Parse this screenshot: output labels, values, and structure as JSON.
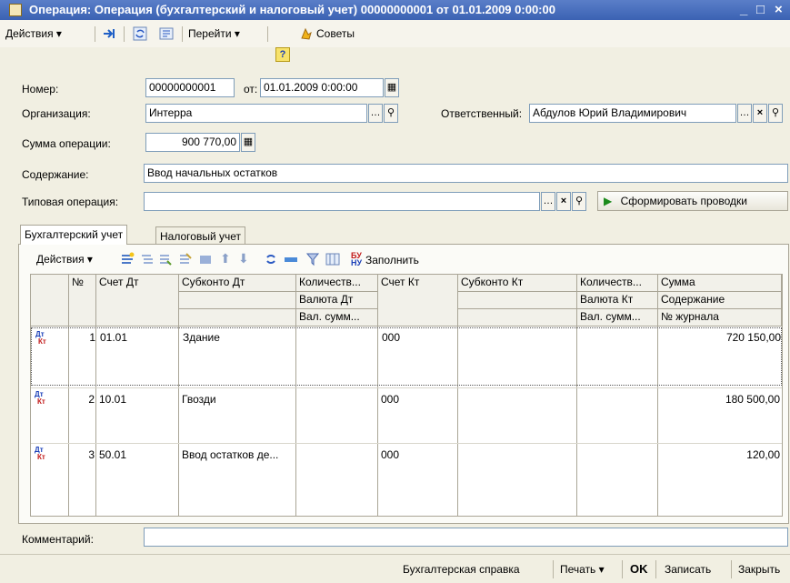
{
  "window": {
    "title": "Операция: Операция (бухгалтерский и налоговый учет) 00000000001 от 01.01.2009 0:00:00",
    "minimize": "_",
    "maximize": "□",
    "close": "×"
  },
  "toolbar": {
    "actions": "Действия",
    "goto": "Перейти",
    "help": "?",
    "tips": "Советы"
  },
  "form": {
    "number_label": "Номер:",
    "number_value": "00000000001",
    "from_label": "от:",
    "date_value": "01.01.2009  0:00:00",
    "org_label": "Организация:",
    "org_value": "Интерра",
    "resp_label": "Ответственный:",
    "resp_value": "Абдулов Юрий Владимирович",
    "sum_label": "Сумма операции:",
    "sum_value": "900 770,00",
    "content_label": "Содержание:",
    "content_value": "Ввод начальных остатков",
    "typical_label": "Типовая операция:",
    "typical_value": "",
    "generate_button": "Сформировать проводки",
    "comment_label": "Комментарий:",
    "comment_value": ""
  },
  "tabs": [
    "Бухгалтерский учет",
    "Налоговый учет"
  ],
  "table_toolbar": {
    "actions": "Действия",
    "fill": "Заполнить"
  },
  "table": {
    "headers": {
      "num": "№",
      "acc_dt": "Счет Дт",
      "sub_dt": "Субконто Дт",
      "qty_dt": "Количеств...",
      "cur_dt": "Валюта Дт",
      "cursum_dt": "Вал. сумм...",
      "acc_kt": "Счет Кт",
      "sub_kt": "Субконто Кт",
      "qty_kt": "Количеств...",
      "cur_kt": "Валюта Кт",
      "cursum_kt": "Вал. сумм...",
      "sum": "Сумма",
      "content": "Содержание",
      "journal": "№ журнала"
    },
    "rows": [
      {
        "icon_dt": "Дт",
        "icon_kt": "Кт",
        "num": "1",
        "acc_dt": "01.01",
        "sub_dt": "Здание",
        "acc_kt": "000",
        "sum": "720 150,00"
      },
      {
        "icon_dt": "Дт",
        "icon_kt": "Кт",
        "num": "2",
        "acc_dt": "10.01",
        "sub_dt": "Гвозди",
        "acc_kt": "000",
        "sum": "180 500,00"
      },
      {
        "icon_dt": "Дт",
        "icon_kt": "Кт",
        "num": "3",
        "acc_dt": "50.01",
        "sub_dt": "Ввод остатков де...",
        "acc_kt": "000",
        "sum": "120,00"
      }
    ]
  },
  "footer": {
    "report": "Бухгалтерская справка",
    "print": "Печать",
    "ok": "OK",
    "save": "Записать",
    "close": "Закрыть"
  }
}
